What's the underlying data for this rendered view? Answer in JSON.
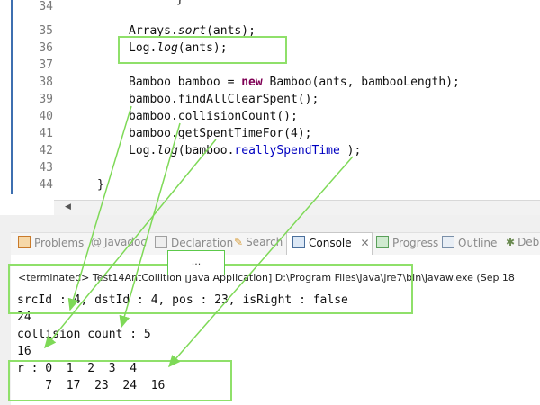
{
  "editor": {
    "lines": [
      {
        "num": "34",
        "text": "}"
      },
      {
        "num": "35",
        "text": "Arrays.sort(ants);"
      },
      {
        "num": "36",
        "text": "Log.log(ants);"
      },
      {
        "num": "37",
        "text": ""
      },
      {
        "num": "38",
        "text": "Bamboo bamboo = new Bamboo(ants, bambooLength);"
      },
      {
        "num": "39",
        "text": "bamboo.findAllClearSpent();"
      },
      {
        "num": "40",
        "text": "bamboo.collisionCount();"
      },
      {
        "num": "41",
        "text": "bamboo.getSpentTimeFor(4);"
      },
      {
        "num": "42",
        "text": "Log.log(bamboo.reallySpendTime );"
      },
      {
        "num": "43",
        "text": ""
      },
      {
        "num": "44",
        "text": "}"
      }
    ],
    "l35": {
      "a": "Arrays.",
      "b": "sort",
      "c": "(ants);"
    },
    "l36": {
      "a": "Log.",
      "b": "log",
      "c": "(ants);"
    },
    "l38": {
      "a": "Bamboo bamboo = ",
      "kw": "new",
      "c": " Bamboo(ants, bambooLength);"
    },
    "l42": {
      "a": "Log.",
      "b": "log",
      "c": "(bamboo.",
      "f": "reallySpendTime",
      "d": " );"
    }
  },
  "tabs": [
    {
      "label": "Problems",
      "icon": "problems-icon"
    },
    {
      "label": "Javadoc",
      "icon": "at-icon"
    },
    {
      "label": "Declaration",
      "icon": "declaration-icon"
    },
    {
      "label": "Search",
      "icon": "search-icon"
    },
    {
      "label": "Console",
      "icon": "console-icon"
    },
    {
      "label": "Progress",
      "icon": "progress-icon"
    },
    {
      "label": "Outline",
      "icon": "outline-icon"
    },
    {
      "label": "Debu",
      "icon": "debug-icon"
    }
  ],
  "console": {
    "header": "<terminated> Test14AntCollition [Java Application] D:\\Program Files\\Java\\jre7\\bin\\javaw.exe (Sep 18",
    "lines": [
      "srcId : 4, dstId : 4, pos : 23, isRight : false",
      "24",
      "collision count : 5",
      "16",
      "r : 0  1  2  3  4",
      "    7  17  23  24  16"
    ]
  },
  "annotation": {
    "ellipsis": "..."
  },
  "colors": {
    "annotation_green": "#7ed957",
    "keyword": "#7f0055",
    "field": "#0000c0"
  }
}
